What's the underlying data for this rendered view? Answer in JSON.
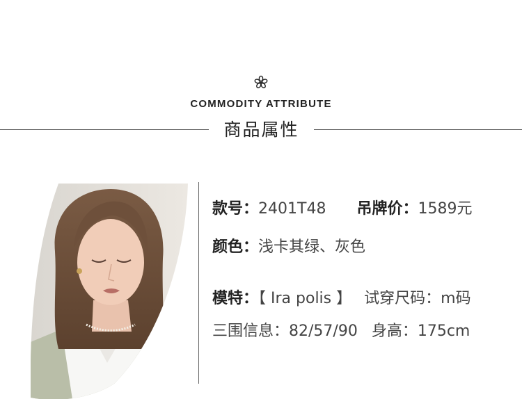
{
  "header": {
    "en_title": "COMMODITY ATTRIBUTE",
    "cn_title": "商品属性"
  },
  "attributes": {
    "style_no_label": "款号：",
    "style_no_value": "2401T48",
    "price_label": "吊牌价：",
    "price_value": "1589元",
    "color_label": "颜色：",
    "color_value": "浅卡其绿、灰色",
    "model_label": "模特：",
    "model_value": "【 Ira polis 】",
    "size_label": "试穿尺码：",
    "size_value": "m码",
    "measurements_label": "三围信息：",
    "measurements_value": "82/57/90",
    "height_label": "身高：",
    "height_value": "175cm"
  }
}
